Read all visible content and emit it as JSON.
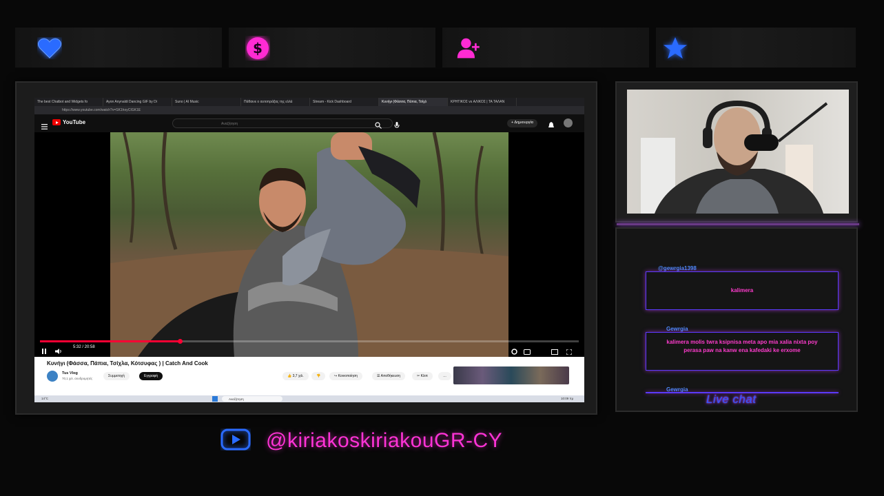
{
  "top_icons": [
    {
      "name": "heart-icon",
      "color": "#2a6bff"
    },
    {
      "name": "dollar-icon",
      "color": "#ff2bd3"
    },
    {
      "name": "add-user-icon",
      "color": "#ff2bd3"
    },
    {
      "name": "star-icon",
      "color": "#2a6bff"
    }
  ],
  "browser": {
    "tabs": [
      "The best Chatbot and Widgets fo",
      "Ayon Anynaldi Dancing GIF by Di",
      "Suno | AI Music",
      "Πάθαινε ο αυτοπράξας της ελλά",
      "Stream - Kick Dashboard",
      "Κυνήγι (Φάσσα, Πάπια, Τσίχλ",
      "ΚΡΗΤΙΚΟΣ vs ΑΛΙΚΟΣ | ΤΑ ΤΑΛΑΝ"
    ],
    "active_tab": 5,
    "url": "https://www.youtube.com/watch?v=SK1hoyCIGK1E"
  },
  "youtube": {
    "logo": "YouTube",
    "search_placeholder": "Αναζήτηση",
    "create_label": "+ Δημιουργία",
    "time": "5:32 / 20:58",
    "progress": 0.26,
    "video_title": "Κυνήγι (Φάσσα, Πάπια, Τσίχλα, Κότσυφας ) | Catch And Cook",
    "channel_name": "Tus Vlog",
    "channel_subs": "70,1 χιλ. συνδρομητές",
    "join_label": "Συμμετοχή",
    "subscribe_label": "Εγγραφή",
    "likes": "3,7 χιλ.",
    "share_label": "Κοινοποίηση",
    "save_label": "Αποθήκευση",
    "clip_label": "Κλιπ"
  },
  "taskbar": {
    "weather": "14°C",
    "search": "Αναζήτηση",
    "clock": "10:09 πμ"
  },
  "chat": {
    "title": "Live chat",
    "messages": [
      {
        "user": "@gewrgia1398",
        "text": "kalimera"
      },
      {
        "user": "Gewrgia",
        "text": "kalimera molis twra ksipnisa meta apo mia xalia nixta poy perasa paw na kanw ena kafedaki ke erxome"
      },
      {
        "user": "Gewrgia",
        "text": ""
      }
    ]
  },
  "social": {
    "icon": "youtube-icon",
    "handle": "@kiriakoskiriakouGR-CY"
  }
}
